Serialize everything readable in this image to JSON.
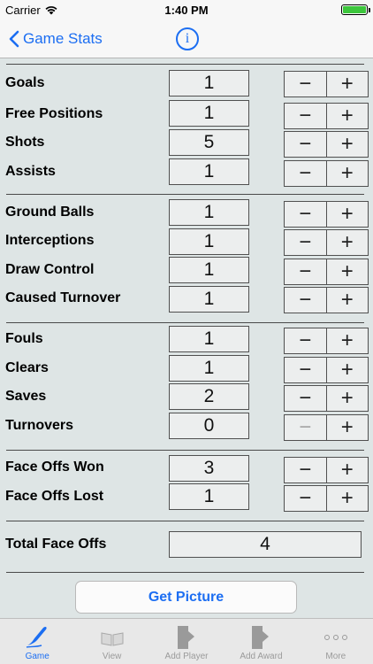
{
  "status_bar": {
    "carrier": "Carrier",
    "time": "1:40 PM"
  },
  "nav": {
    "back_label": "Game Stats",
    "info_symbol": "i"
  },
  "groups": [
    [
      {
        "label": "Goals",
        "value": "1"
      },
      {
        "label": "Free Positions",
        "value": "1"
      },
      {
        "label": "Shots",
        "value": "5"
      },
      {
        "label": "Assists",
        "value": "1"
      }
    ],
    [
      {
        "label": "Ground Balls",
        "value": "1"
      },
      {
        "label": "Interceptions",
        "value": "1"
      },
      {
        "label": "Draw Control",
        "value": "1"
      },
      {
        "label": "Caused Turnover",
        "value": "1"
      }
    ],
    [
      {
        "label": "Fouls",
        "value": "1"
      },
      {
        "label": "Clears",
        "value": "1"
      },
      {
        "label": "Saves",
        "value": "2"
      },
      {
        "label": "Turnovers",
        "value": "0",
        "minus_disabled": true
      }
    ],
    [
      {
        "label": "Face Offs Won",
        "value": "3"
      },
      {
        "label": "Face Offs Lost",
        "value": "1"
      }
    ]
  ],
  "stepper": {
    "minus": "−",
    "plus": "+"
  },
  "total_face_offs": {
    "label": "Total Face Offs",
    "value": "4"
  },
  "get_picture_label": "Get Picture",
  "tabs": [
    {
      "label": "Game",
      "icon": "pen-icon",
      "active": true
    },
    {
      "label": "View",
      "icon": "book-icon",
      "active": false
    },
    {
      "label": "Add Player",
      "icon": "document-add-icon",
      "active": false
    },
    {
      "label": "Add Award",
      "icon": "document-add-icon",
      "active": false
    },
    {
      "label": "More",
      "icon": "more-dots-icon",
      "active": false
    }
  ],
  "colors": {
    "accent": "#1c6ef2",
    "background": "#dee5e5",
    "battery": "#3cc63c"
  }
}
